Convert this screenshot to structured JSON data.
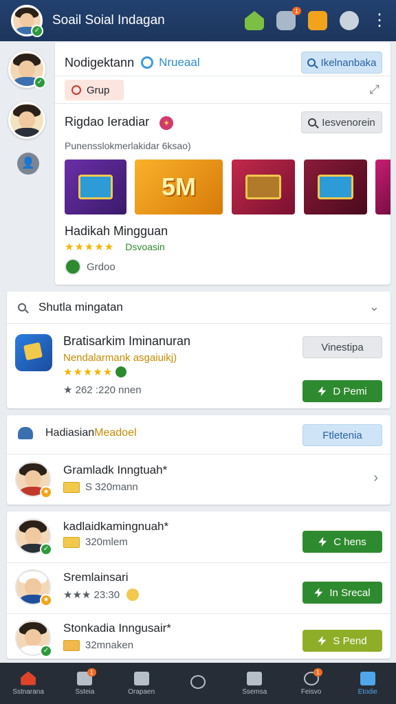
{
  "topbar": {
    "title": "Soail Soial Indagan",
    "icons": [
      "home-icon",
      "chat-icon",
      "book-icon",
      "sync-icon",
      "more-icon"
    ],
    "badges": {
      "chat": "1",
      "book": ""
    }
  },
  "main_card": {
    "title": "Nodigektann",
    "subtitle": "Nrueaal",
    "search_button": "Ikelnanbaka",
    "group_label": "Grup",
    "section_title": "Rigdao Ieradiar",
    "section_button": "Iesvenorein",
    "caption": "Punensslokmerlakidar 6ksao)",
    "thumb2_text": "5M",
    "reward_title": "Hadikah Mingguan",
    "reward_stars": "★★★★★",
    "reward_tag": "Dsvoasin",
    "reward_user": "Grdoo"
  },
  "search_card": {
    "header": "Shutla mingatan",
    "item_name": "Bratisarkim Iminanuran",
    "item_desc": "Nendalarmank asgaiuikj)",
    "item_stars": "★★★★★",
    "item_size": "★ 262 :220 nnen",
    "button_secondary": "Vinestipa",
    "button_primary": "D Pemi"
  },
  "section_card": {
    "header_prefix": "Hadiasian ",
    "header_highlight": "Meadoel",
    "header_button": "Ftletenia",
    "row_name": "Gramladk Inngtuah*",
    "row_meta": "S 320mann"
  },
  "list_card": {
    "rows": [
      {
        "name": "kadlaidkamingnuah*",
        "meta": "320mlem",
        "button": "C hens"
      },
      {
        "name": "Sremlainsari",
        "meta": "★★★ 23:30",
        "button": "In Srecal"
      },
      {
        "name": "Stonkadia Inngusair*",
        "meta": "32mnaken",
        "button": "S Pend"
      }
    ]
  },
  "bottom_nav": {
    "items": [
      {
        "label": "Sstnarana",
        "icon": "home-icon",
        "badge": ""
      },
      {
        "label": "Ssteia",
        "icon": "chart-icon",
        "badge": "1"
      },
      {
        "label": "Orapaen",
        "icon": "mail-icon",
        "badge": ""
      },
      {
        "label": "",
        "icon": "chat-icon",
        "badge": ""
      },
      {
        "label": "Ssemsa",
        "icon": "store-icon",
        "badge": ""
      },
      {
        "label": "Feisvo",
        "icon": "refresh-icon",
        "badge": "1"
      },
      {
        "label": "Etodie",
        "icon": "games-icon",
        "badge": ""
      }
    ]
  },
  "colors": {
    "topbar": "#1c355c",
    "accent_green": "#2e8a2e",
    "accent_blue": "#2c8cd1",
    "star": "#f4b400",
    "nav_active": "#4fa6e8"
  }
}
